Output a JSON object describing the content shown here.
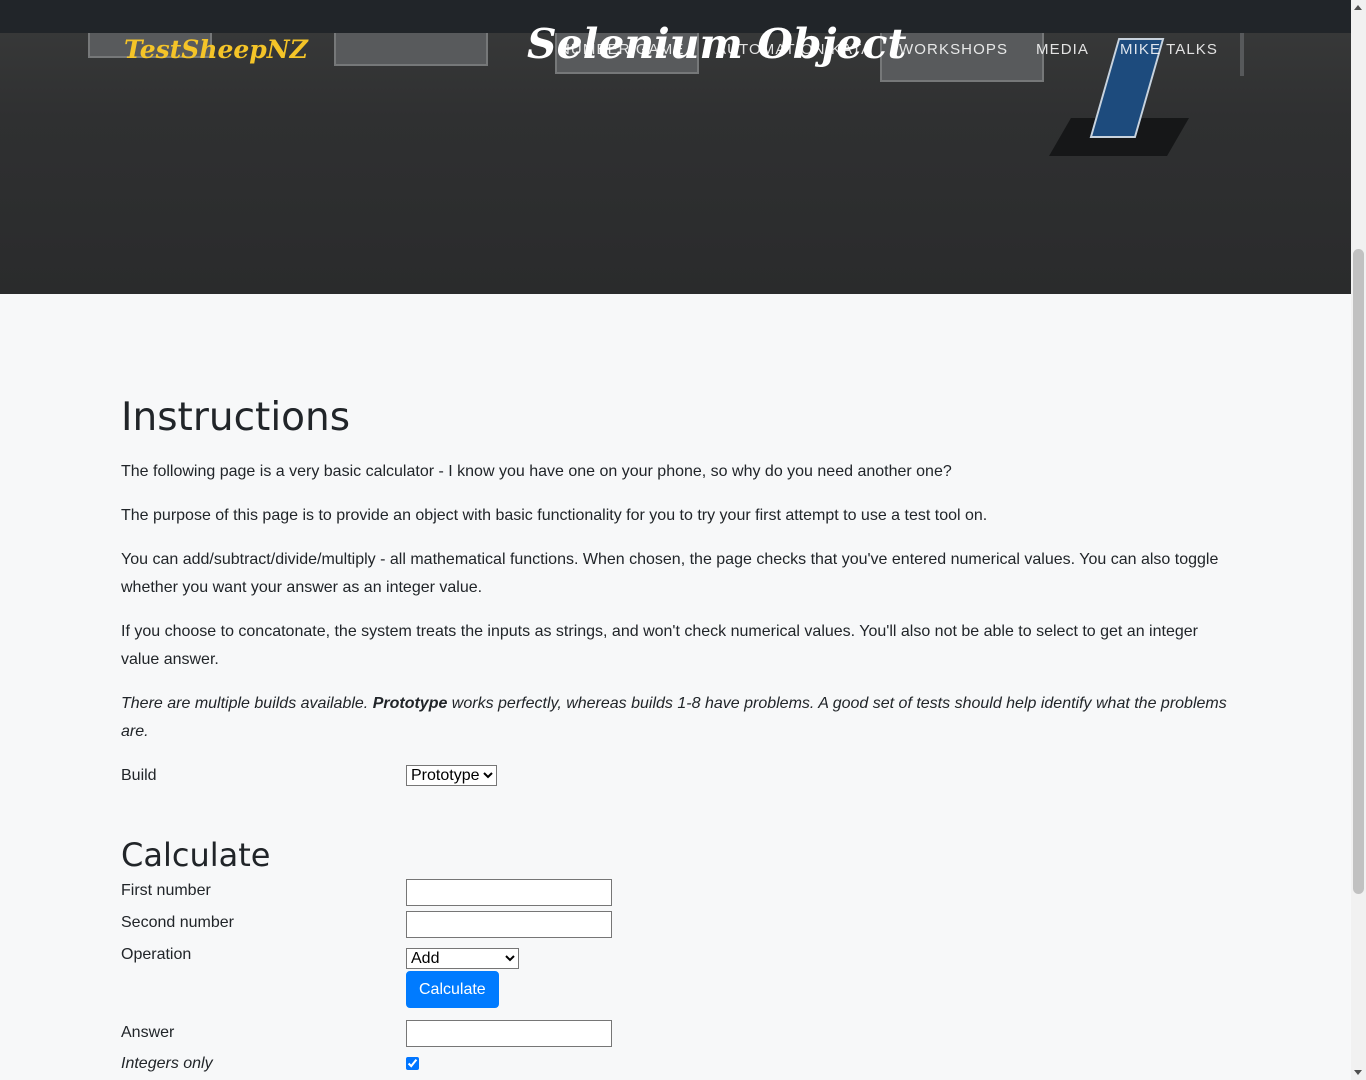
{
  "header": {
    "brand": "TestSheepNZ",
    "hero_title": "Selenium Object",
    "nav": [
      "NUMBER GAME",
      "AUTOMATION KATA",
      "WORKSHOPS",
      "MEDIA",
      "MIKE TALKS"
    ]
  },
  "instructions": {
    "heading": "Instructions",
    "paragraphs": [
      "The following page is a very basic calculator - I know you have one on your phone, so why do you need another one?",
      "The purpose of this page is to provide an object with basic functionality for you to try your first attempt to use a test tool on.",
      "You can add/subtract/divide/multiply - all mathematical functions. When chosen, the page checks that you've entered numerical values. You can also toggle whether you want your answer as an integer value.",
      "If you choose to concatonate, the system treats the inputs as strings, and won't check numerical values. You'll also not be able to select to get an integer value answer."
    ],
    "note_before": "There are multiple builds available. ",
    "note_bold": "Prototype",
    "note_after": " works perfectly, whereas builds 1-8 have problems. A good set of tests should help identify what the problems are."
  },
  "build": {
    "label": "Build",
    "selected": "Prototype"
  },
  "calculate": {
    "heading": "Calculate",
    "first_label": "First number",
    "first_value": "",
    "second_label": "Second number",
    "second_value": "",
    "operation_label": "Operation",
    "operation_selected": "Add",
    "button": "Calculate",
    "answer_label": "Answer",
    "answer_value": "",
    "integers_label": "Integers only",
    "integers_checked": true
  },
  "colors": {
    "brand": "#f4c428",
    "primary_button": "#007bff",
    "nav_bar": "#212529"
  }
}
